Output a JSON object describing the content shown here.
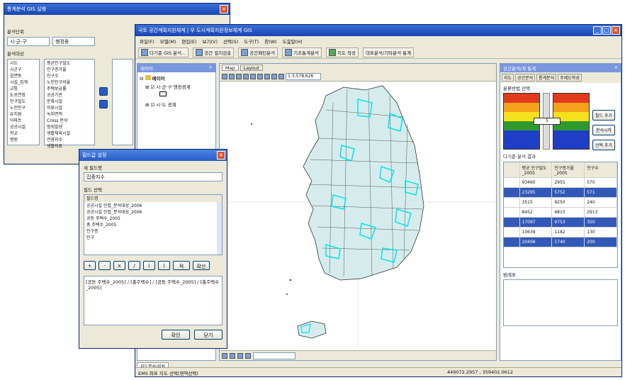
{
  "main_window": {
    "title": "국토 공간계획지원체계 | 우 도시계획지원정보체계 GIS",
    "menu": [
      "파일(F)",
      "모델(M)",
      "편집(E)",
      "보기(V)",
      "선택(S)",
      "도구(T)",
      "창(W)",
      "도움말(H)"
    ],
    "toolbar": [
      "다기준 GIS 분석...",
      "공간 필지검출",
      "공간패턴분석",
      "기초통계분석",
      "지도 작성",
      "대표분석/기타분석 통계"
    ],
    "status_left": "EMS 좌표 지도 선택(영역선택)",
    "status_coords": "449072.2957 , 359402.0612"
  },
  "toc": {
    "title": "레이어",
    "root": "레이어",
    "items": [
      "시·군·구 행정경계",
      "시·도 경계"
    ]
  },
  "map": {
    "tabs": [
      "Map",
      "Layout"
    ],
    "scale": "1:3,578,626",
    "bottom_tab": "지도분석/지원"
  },
  "right_panel": {
    "title": "공간분석/계 통계",
    "tabs": [
      "지도",
      "공간분석",
      "통계분석",
      "주제도작성"
    ],
    "classify_label": "분류방법 선택",
    "slider_value": "5",
    "buttons": [
      "필드 추가",
      "분석시작",
      "선택 추가"
    ],
    "table_label": "다기준 분석 결과",
    "table_headers": [
      "",
      "평균 인구밀도_2005",
      "인구증가율_2005",
      "인구수"
    ],
    "rows": [
      {
        "c1": "",
        "c2": "93460",
        "c3": "2955",
        "c4": "570",
        "sel": false
      },
      {
        "c1": "",
        "c2": "23295",
        "c3": "5752",
        "c4": "571",
        "sel": true
      },
      {
        "c1": "",
        "c2": "3515",
        "c3": "9250",
        "c4": "240",
        "sel": false
      },
      {
        "c1": "",
        "c2": "8452",
        "c3": "6815",
        "c4": "2913",
        "sel": false
      },
      {
        "c1": "",
        "c2": "17097",
        "c3": "9753",
        "c4": "350",
        "sel": true
      },
      {
        "c1": "",
        "c2": "10639",
        "c3": "1182",
        "c4": "130",
        "sel": false
      },
      {
        "c1": "",
        "c2": "20498",
        "c3": "1740",
        "c4": "200",
        "sel": true
      }
    ],
    "lower_label": "범례표"
  },
  "back_dialog": {
    "title": "통계분석 GIS 실행",
    "label_a": "분석단위",
    "label_b": "분석대상",
    "combo_a": "시·군·구",
    "combo_b": "행정동",
    "left_items": [
      "시도",
      "시군구",
      "읍면동",
      "시설_집계",
      "교통",
      "도로연장",
      "인구밀도",
      "노인인구",
      "유치원",
      "아파트",
      "공공시설",
      "학교",
      "병원"
    ],
    "mid_items": [
      "평균인구밀도",
      "인구증가율",
      "인구수",
      "노인인구비율",
      "주택보급률",
      "공공기관",
      "문화시설",
      "의료시설",
      "녹지면적",
      "Cross 분석",
      "범죄발생",
      "생활체육시설",
      "관광지수",
      "생활지표"
    ]
  },
  "field_dialog": {
    "title": "필드값 설정",
    "label_name": "새 필드명",
    "name_value": "집중지수",
    "label_select": "필드 선택",
    "list_head": "필드명",
    "list_items": [
      "공공시설 인접_분석대상_2006",
      "공공시설 인접_분석대상_2006",
      "공동 주택수_2005",
      "총 주택수_2005",
      "인구증",
      "인구"
    ],
    "operators": [
      "+",
      "-",
      "x",
      "/",
      "(",
      ")",
      "적",
      "확산"
    ],
    "expression": "[공동 주택수_2005] / [총주택수] / [공동 주택수_2005] / [총주택수_2005]",
    "ok": "확인",
    "cancel": "닫기"
  }
}
